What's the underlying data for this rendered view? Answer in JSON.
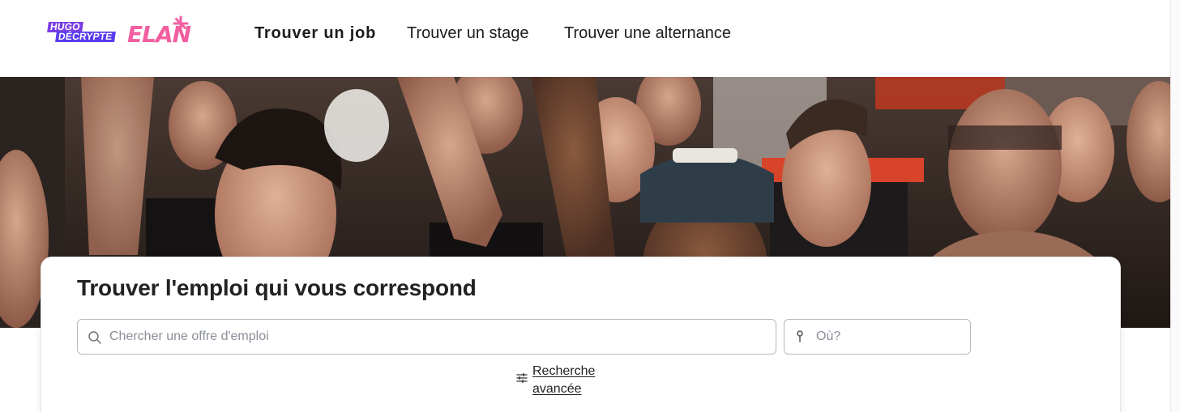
{
  "header": {
    "logo_hugo_line1": "HUGO",
    "logo_hugo_line2": "DÉCRYPTE",
    "logo_elan": "ELAN",
    "nav": [
      {
        "label": "Trouver un job"
      },
      {
        "label": "Trouver un stage"
      },
      {
        "label": "Trouver une alternance"
      }
    ]
  },
  "hero": {
    "icon": "crowd-photo"
  },
  "search": {
    "title": "Trouver l'emploi qui vous correspond",
    "job_placeholder": "Chercher une offre d'emploi",
    "job_value": "",
    "where_placeholder": "Où?",
    "where_value": "",
    "advanced_label": "Recherche avancée",
    "icons": {
      "job": "search-icon",
      "where": "location-pin-icon",
      "advanced": "sliders-icon"
    }
  },
  "colors": {
    "brand_pink": "#f25ea0",
    "brand_purple": "#7b3fe4",
    "text": "#1c1c1c"
  }
}
